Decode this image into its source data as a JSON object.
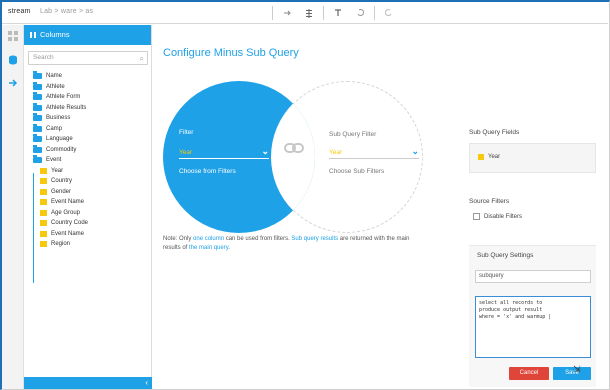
{
  "app": {
    "brand": "stream",
    "breadcrumb": "Lab  >  ware  >  as"
  },
  "toolbar": {
    "icons": [
      "arrow-icon",
      "list-icon",
      "T-icon",
      "undo-icon",
      "redo-icon"
    ]
  },
  "sidebar": {
    "header": "Columns",
    "search_placeholder": "Search",
    "folders": [
      {
        "label": "Name"
      },
      {
        "label": "Athlete"
      },
      {
        "label": "Athlete Form"
      },
      {
        "label": "Athlete Results"
      },
      {
        "label": "Business"
      },
      {
        "label": "Camp"
      },
      {
        "label": "Language"
      },
      {
        "label": "Commodity"
      },
      {
        "label": "Event"
      }
    ],
    "fields": [
      {
        "label": "Year"
      },
      {
        "label": "Country"
      },
      {
        "label": "Gender"
      },
      {
        "label": "Event Name"
      },
      {
        "label": "Age Group"
      },
      {
        "label": "Country Code"
      },
      {
        "label": "Event Name"
      },
      {
        "label": "Region"
      }
    ]
  },
  "main": {
    "title": "Configure Minus Sub Query",
    "left_circle": {
      "heading": "Filter",
      "select_value": "Year",
      "link": "Choose from Filters"
    },
    "right_circle": {
      "heading": "Sub Query Filter",
      "select_value": "Year",
      "link": "Choose Sub Filters"
    },
    "warning_prefix": "Note: Only ",
    "warning_hl1": "one column",
    "warning_mid": " can be used from filters. ",
    "warning_hl2": "Sub query results",
    "warning_suffix": " are returned with the main ",
    "warning_line2": "results of ",
    "warning_hl3": "the main query",
    "warning_end": "."
  },
  "right_panel": {
    "section_label": "Sub Query Fields",
    "field_chip": "Year",
    "source_filters_label": "Source Filters",
    "checkbox_label": "Disable Filters",
    "panel_label": "Sub Query Settings",
    "name_value": "subquery",
    "code_lines": [
      "select all records to",
      "produce output result",
      "where = 'x' and warmup |"
    ],
    "cancel": "Cancel",
    "save": "Save"
  },
  "colors": {
    "accent": "#1ea1e6",
    "danger": "#e0453a",
    "folder_yellow": "#f6c90e"
  }
}
